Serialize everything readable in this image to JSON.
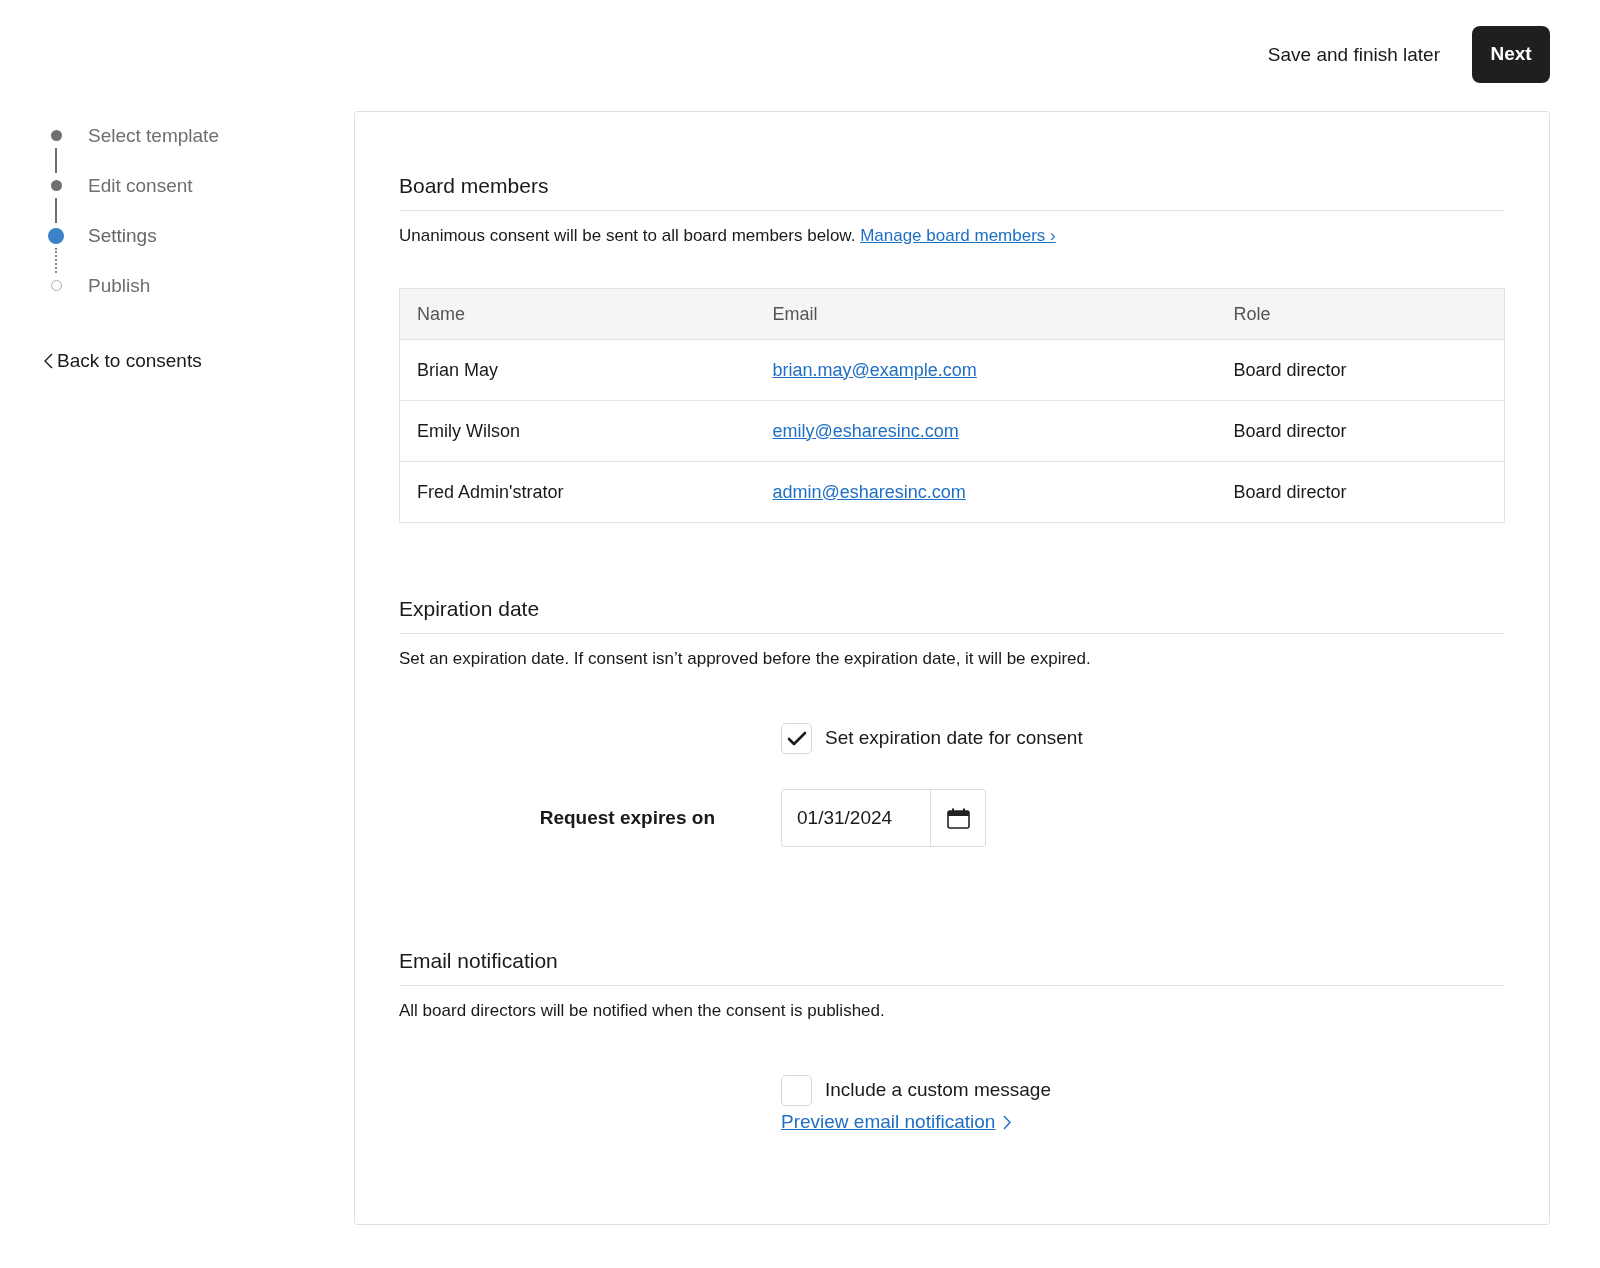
{
  "header": {
    "secondary_button": "Save and finish later",
    "primary_button": "Next"
  },
  "steps": [
    {
      "label": "Select template",
      "kind": "done"
    },
    {
      "label": "Edit consent",
      "kind": "done"
    },
    {
      "label": "Settings",
      "kind": "current"
    },
    {
      "label": "Publish",
      "kind": "upcoming"
    }
  ],
  "back_link": "Back to consents",
  "board_members": {
    "title": "Board members",
    "description": "Unanimous consent will be sent to all board members below.",
    "link": "Manage board members ›",
    "table": {
      "columns": [
        "Name",
        "Email",
        "Role"
      ],
      "rows": [
        [
          "Brian May",
          "brian.may@example.com",
          "Board director"
        ],
        [
          "Emily Wilson",
          "emily@esharesinc.com",
          "Board director"
        ],
        [
          "Fred Admin'strator",
          "admin@esharesinc.com",
          "Board director"
        ]
      ]
    }
  },
  "expiration": {
    "title": "Expiration date",
    "description": "Set an expiration date. If consent isn’t approved before the expiration date, it will be expired.",
    "checkbox": {
      "label": "Set expiration date for consent",
      "checked": true
    },
    "date_label": "Request expires on",
    "date_value": "01/31/2024"
  },
  "email_notification": {
    "title": "Email notification",
    "description": "All board directors will be notified when the consent is published.",
    "checkbox": {
      "label": "Include a custom message",
      "checked": false
    },
    "link": "Preview email notification"
  }
}
